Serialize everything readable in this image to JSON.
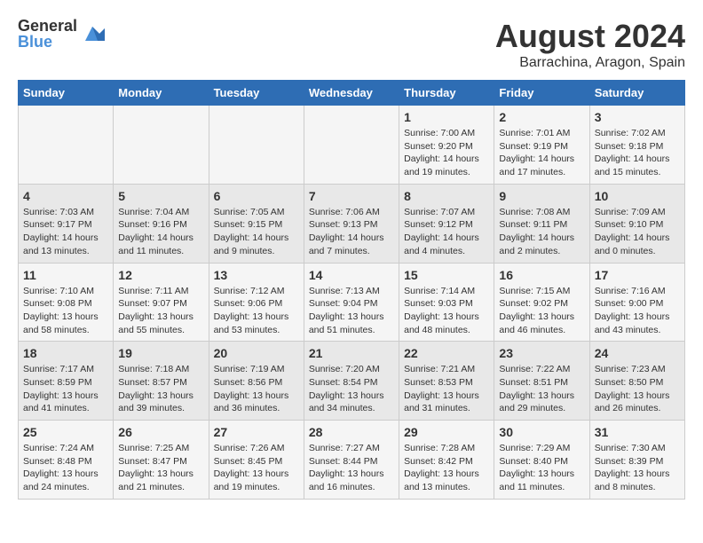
{
  "header": {
    "logo_general": "General",
    "logo_blue": "Blue",
    "month": "August 2024",
    "location": "Barrachina, Aragon, Spain"
  },
  "days_of_week": [
    "Sunday",
    "Monday",
    "Tuesday",
    "Wednesday",
    "Thursday",
    "Friday",
    "Saturday"
  ],
  "weeks": [
    [
      {
        "day": "",
        "info": ""
      },
      {
        "day": "",
        "info": ""
      },
      {
        "day": "",
        "info": ""
      },
      {
        "day": "",
        "info": ""
      },
      {
        "day": "1",
        "info": "Sunrise: 7:00 AM\nSunset: 9:20 PM\nDaylight: 14 hours\nand 19 minutes."
      },
      {
        "day": "2",
        "info": "Sunrise: 7:01 AM\nSunset: 9:19 PM\nDaylight: 14 hours\nand 17 minutes."
      },
      {
        "day": "3",
        "info": "Sunrise: 7:02 AM\nSunset: 9:18 PM\nDaylight: 14 hours\nand 15 minutes."
      }
    ],
    [
      {
        "day": "4",
        "info": "Sunrise: 7:03 AM\nSunset: 9:17 PM\nDaylight: 14 hours\nand 13 minutes."
      },
      {
        "day": "5",
        "info": "Sunrise: 7:04 AM\nSunset: 9:16 PM\nDaylight: 14 hours\nand 11 minutes."
      },
      {
        "day": "6",
        "info": "Sunrise: 7:05 AM\nSunset: 9:15 PM\nDaylight: 14 hours\nand 9 minutes."
      },
      {
        "day": "7",
        "info": "Sunrise: 7:06 AM\nSunset: 9:13 PM\nDaylight: 14 hours\nand 7 minutes."
      },
      {
        "day": "8",
        "info": "Sunrise: 7:07 AM\nSunset: 9:12 PM\nDaylight: 14 hours\nand 4 minutes."
      },
      {
        "day": "9",
        "info": "Sunrise: 7:08 AM\nSunset: 9:11 PM\nDaylight: 14 hours\nand 2 minutes."
      },
      {
        "day": "10",
        "info": "Sunrise: 7:09 AM\nSunset: 9:10 PM\nDaylight: 14 hours\nand 0 minutes."
      }
    ],
    [
      {
        "day": "11",
        "info": "Sunrise: 7:10 AM\nSunset: 9:08 PM\nDaylight: 13 hours\nand 58 minutes."
      },
      {
        "day": "12",
        "info": "Sunrise: 7:11 AM\nSunset: 9:07 PM\nDaylight: 13 hours\nand 55 minutes."
      },
      {
        "day": "13",
        "info": "Sunrise: 7:12 AM\nSunset: 9:06 PM\nDaylight: 13 hours\nand 53 minutes."
      },
      {
        "day": "14",
        "info": "Sunrise: 7:13 AM\nSunset: 9:04 PM\nDaylight: 13 hours\nand 51 minutes."
      },
      {
        "day": "15",
        "info": "Sunrise: 7:14 AM\nSunset: 9:03 PM\nDaylight: 13 hours\nand 48 minutes."
      },
      {
        "day": "16",
        "info": "Sunrise: 7:15 AM\nSunset: 9:02 PM\nDaylight: 13 hours\nand 46 minutes."
      },
      {
        "day": "17",
        "info": "Sunrise: 7:16 AM\nSunset: 9:00 PM\nDaylight: 13 hours\nand 43 minutes."
      }
    ],
    [
      {
        "day": "18",
        "info": "Sunrise: 7:17 AM\nSunset: 8:59 PM\nDaylight: 13 hours\nand 41 minutes."
      },
      {
        "day": "19",
        "info": "Sunrise: 7:18 AM\nSunset: 8:57 PM\nDaylight: 13 hours\nand 39 minutes."
      },
      {
        "day": "20",
        "info": "Sunrise: 7:19 AM\nSunset: 8:56 PM\nDaylight: 13 hours\nand 36 minutes."
      },
      {
        "day": "21",
        "info": "Sunrise: 7:20 AM\nSunset: 8:54 PM\nDaylight: 13 hours\nand 34 minutes."
      },
      {
        "day": "22",
        "info": "Sunrise: 7:21 AM\nSunset: 8:53 PM\nDaylight: 13 hours\nand 31 minutes."
      },
      {
        "day": "23",
        "info": "Sunrise: 7:22 AM\nSunset: 8:51 PM\nDaylight: 13 hours\nand 29 minutes."
      },
      {
        "day": "24",
        "info": "Sunrise: 7:23 AM\nSunset: 8:50 PM\nDaylight: 13 hours\nand 26 minutes."
      }
    ],
    [
      {
        "day": "25",
        "info": "Sunrise: 7:24 AM\nSunset: 8:48 PM\nDaylight: 13 hours\nand 24 minutes."
      },
      {
        "day": "26",
        "info": "Sunrise: 7:25 AM\nSunset: 8:47 PM\nDaylight: 13 hours\nand 21 minutes."
      },
      {
        "day": "27",
        "info": "Sunrise: 7:26 AM\nSunset: 8:45 PM\nDaylight: 13 hours\nand 19 minutes."
      },
      {
        "day": "28",
        "info": "Sunrise: 7:27 AM\nSunset: 8:44 PM\nDaylight: 13 hours\nand 16 minutes."
      },
      {
        "day": "29",
        "info": "Sunrise: 7:28 AM\nSunset: 8:42 PM\nDaylight: 13 hours\nand 13 minutes."
      },
      {
        "day": "30",
        "info": "Sunrise: 7:29 AM\nSunset: 8:40 PM\nDaylight: 13 hours\nand 11 minutes."
      },
      {
        "day": "31",
        "info": "Sunrise: 7:30 AM\nSunset: 8:39 PM\nDaylight: 13 hours\nand 8 minutes."
      }
    ]
  ]
}
